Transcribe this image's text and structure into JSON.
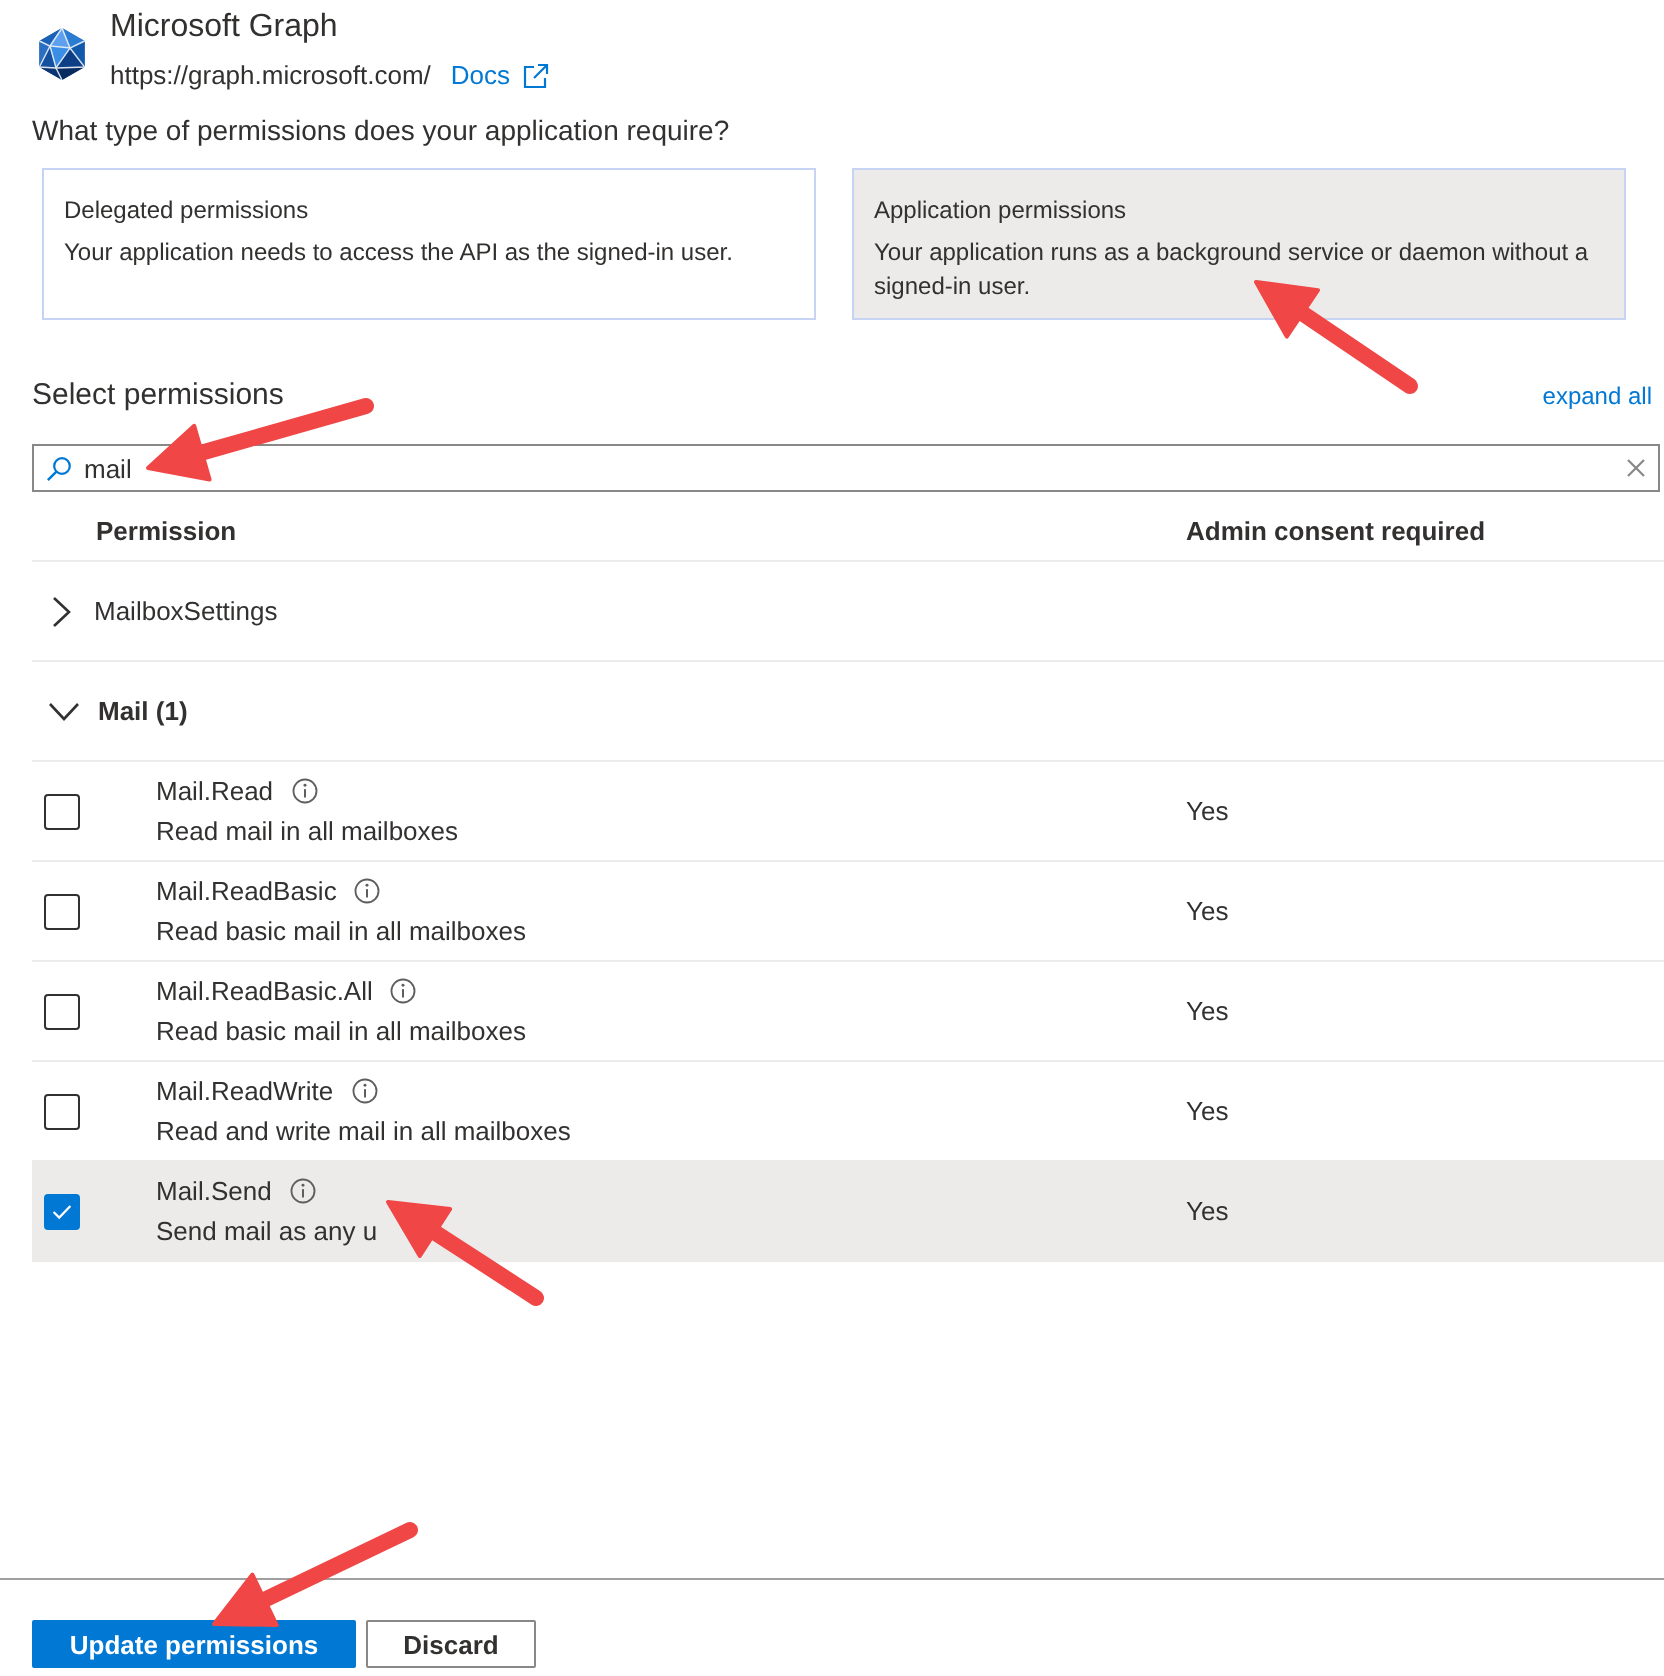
{
  "api": {
    "name": "Microsoft Graph",
    "url": "https://graph.microsoft.com/",
    "docs_link": "Docs"
  },
  "question": "What type of permissions does your application require?",
  "permission_types": [
    {
      "title": "Delegated permissions",
      "description": "Your application needs to access the API as the signed-in user.",
      "selected": false
    },
    {
      "title": "Application permissions",
      "description": "Your application runs as a background service or daemon without a signed-in user.",
      "selected": true
    }
  ],
  "select_permissions": {
    "heading": "Select permissions",
    "expand_all": "expand all"
  },
  "search": {
    "value": "mail"
  },
  "table": {
    "columns": [
      "Permission",
      "Admin consent required"
    ],
    "groups": [
      {
        "name": "MailboxSettings",
        "expanded": false
      },
      {
        "name": "Mail (1)",
        "expanded": true,
        "children": [
          {
            "name": "Mail.Read",
            "description": "Read mail in all mailboxes",
            "admin_consent": "Yes",
            "checked": false
          },
          {
            "name": "Mail.ReadBasic",
            "description": "Read basic mail in all mailboxes",
            "admin_consent": "Yes",
            "checked": false
          },
          {
            "name": "Mail.ReadBasic.All",
            "description": "Read basic mail in all mailboxes",
            "admin_consent": "Yes",
            "checked": false
          },
          {
            "name": "Mail.ReadWrite",
            "description": "Read and write mail in all mailboxes",
            "admin_consent": "Yes",
            "checked": false
          },
          {
            "name": "Mail.Send",
            "description": "Send mail as any u",
            "admin_consent": "Yes",
            "checked": true
          }
        ]
      }
    ]
  },
  "buttons": [
    {
      "label": "Update permissions",
      "kind": "primary"
    },
    {
      "label": "Discard",
      "kind": "default"
    }
  ]
}
